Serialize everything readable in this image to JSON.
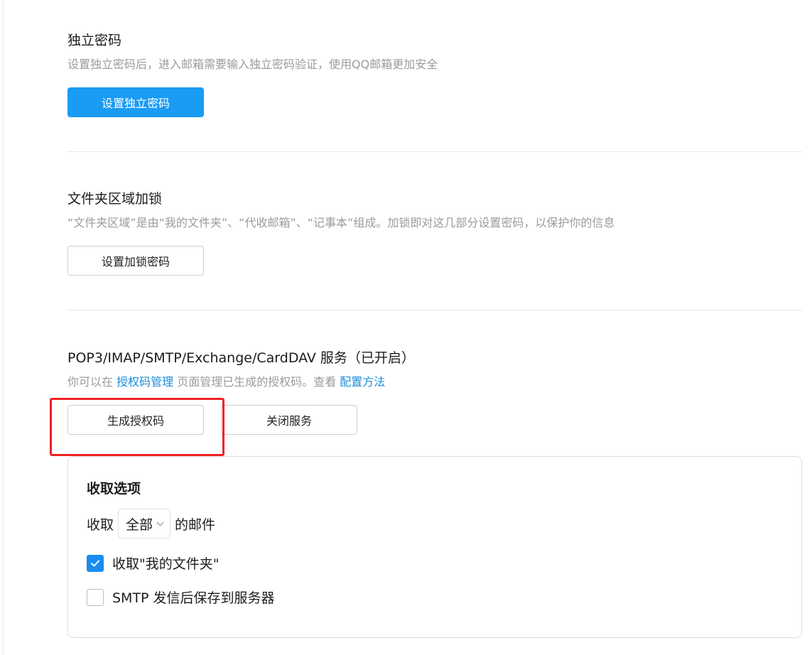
{
  "independent_password": {
    "title": "独立密码",
    "description": "设置独立密码后，进入邮箱需要输入独立密码验证，使用QQ邮箱更加安全",
    "button_label": "设置独立密码"
  },
  "folder_lock": {
    "title": "文件夹区域加锁",
    "description": "“文件夹区域”是由“我的文件夹”、“代收邮箱”、“记事本”组成。加锁即对这几部分设置密码，以保护你的信息",
    "button_label": "设置加锁密码"
  },
  "mail_service": {
    "title": "POP3/IMAP/SMTP/Exchange/CardDAV 服务（已开启）",
    "desc_prefix": "你可以在 ",
    "auth_link": "授权码管理",
    "desc_middle": " 页面管理已生成的授权码。查看 ",
    "config_link": "配置方法",
    "generate_button": "生成授权码",
    "close_button": "关闭服务"
  },
  "fetch_options": {
    "title": "收取选项",
    "fetch_prefix": "收取",
    "range_selected": "全部",
    "fetch_suffix": "的邮件",
    "checkbox_my_folders": {
      "label": "收取\"我的文件夹\"",
      "checked": true
    },
    "checkbox_smtp_save": {
      "label": "SMTP 发信后保存到服务器",
      "checked": false
    }
  },
  "colors": {
    "primary": "#1a9bf4",
    "link": "#1a8cd8",
    "highlight": "#ee2222"
  }
}
